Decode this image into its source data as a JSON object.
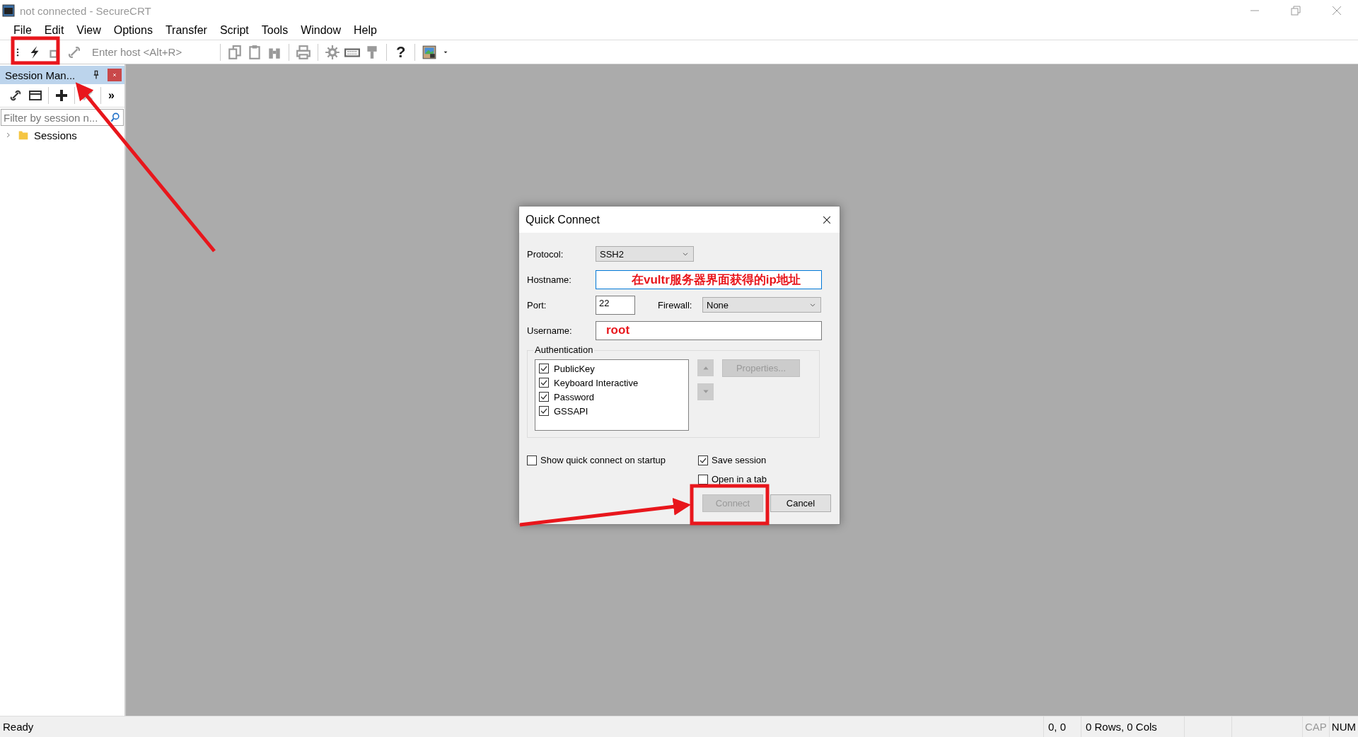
{
  "window": {
    "title": "not connected - SecureCRT"
  },
  "menu": [
    "File",
    "Edit",
    "View",
    "Options",
    "Transfer",
    "Script",
    "Tools",
    "Window",
    "Help"
  ],
  "toolbar": {
    "host_field": {
      "placeholder": "Enter host <Alt+R>"
    },
    "help": "?"
  },
  "session_manager": {
    "title": "Session Man...",
    "more": "»",
    "filter": {
      "placeholder": "Filter by session n..."
    },
    "tree": [
      {
        "label": "Sessions",
        "expanded": false
      }
    ]
  },
  "dialog": {
    "title": "Quick Connect",
    "protocol": {
      "label": "Protocol:",
      "value": "SSH2"
    },
    "hostname": {
      "label": "Hostname:",
      "value": "在vultr服务器界面获得的ip地址"
    },
    "port": {
      "label": "Port:",
      "value": "22"
    },
    "firewall": {
      "label": "Firewall:",
      "value": "None"
    },
    "username": {
      "label": "Username:",
      "value": "root"
    },
    "authentication": {
      "title": "Authentication",
      "methods": [
        {
          "label": "PublicKey",
          "checked": true
        },
        {
          "label": "Keyboard Interactive",
          "checked": true
        },
        {
          "label": "Password",
          "checked": true
        },
        {
          "label": "GSSAPI",
          "checked": true
        }
      ],
      "properties": {
        "label": "Properties...",
        "disabled": true
      }
    },
    "options": [
      {
        "label": "Show quick connect on startup",
        "checked": false
      },
      {
        "label": "Save session",
        "checked": true
      },
      {
        "label": "Open in a tab",
        "checked": false
      }
    ],
    "buttons": [
      {
        "label": "Connect",
        "disabled": true
      },
      {
        "label": "Cancel",
        "disabled": false
      }
    ]
  },
  "status_bar": {
    "items": [
      "Ready",
      "0, 0",
      "0 Rows, 0 Cols"
    ],
    "indicators": [
      {
        "label": "CAP",
        "on": false
      },
      {
        "label": "NUM",
        "on": true
      }
    ]
  }
}
